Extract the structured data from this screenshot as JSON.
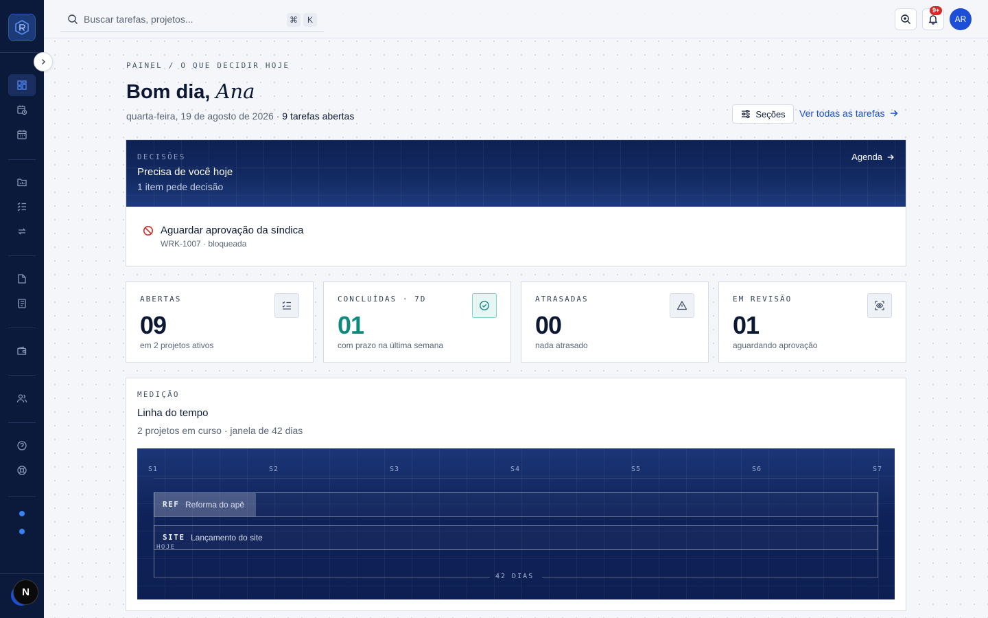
{
  "colors": {
    "sidebar_bg": "#0b1a3a",
    "accent": "#1d4ed8",
    "teal": "#0d8a7c",
    "danger": "#dc2626",
    "banner": "#132a62"
  },
  "sidebar": {
    "items": [
      {
        "icon": "dashboard-icon",
        "active": true
      },
      {
        "icon": "calendar-clock-icon"
      },
      {
        "icon": "calendar-icon"
      },
      {
        "icon": "folder-chart-icon"
      },
      {
        "icon": "checklist-icon"
      },
      {
        "icon": "repeat-icon"
      },
      {
        "icon": "file-icon"
      },
      {
        "icon": "notebook-icon"
      },
      {
        "icon": "wallet-icon"
      },
      {
        "icon": "users-icon"
      },
      {
        "icon": "help-icon"
      },
      {
        "icon": "lifebuoy-icon"
      }
    ],
    "badge_letter": "N"
  },
  "topbar": {
    "search_placeholder": "Buscar tarefas, projetos...",
    "shortcut_cmd": "⌘",
    "shortcut_key": "K",
    "notif_badge": "9+",
    "avatar_initials": "AR"
  },
  "header": {
    "breadcrumb": "PAINEL / O QUE DECIDIR HOJE",
    "greeting": "Bom dia,",
    "name": "Ana",
    "date": "quarta-feira, 19 de agosto de 2026 · ",
    "open_tasks": "9 tarefas abertas",
    "sections_button": "Seções",
    "all_tasks_link": "Ver todas as tarefas"
  },
  "decisions": {
    "label": "DECISÕES",
    "title": "Precisa de você hoje",
    "subtitle": "1 item pede decisão",
    "agenda_link": "Agenda",
    "items": [
      {
        "title": "Aguardar aprovação da síndica",
        "meta": "WRK-1007 · bloqueada"
      }
    ]
  },
  "stats": [
    {
      "label": "ABERTAS",
      "value": "09",
      "desc": "em 2 projetos ativos",
      "icon": "checklist-icon",
      "tone": "neutral"
    },
    {
      "label": "CONCLUÍDAS · 7D",
      "value": "01",
      "desc": "com prazo na última semana",
      "icon": "check-circle-icon",
      "tone": "teal"
    },
    {
      "label": "ATRASADAS",
      "value": "00",
      "desc": "nada atrasado",
      "icon": "warning-icon",
      "tone": "neutral"
    },
    {
      "label": "EM REVISÃO",
      "value": "01",
      "desc": "aguardando aprovação",
      "icon": "focus-eye-icon",
      "tone": "neutral"
    }
  ],
  "timeline": {
    "label": "MEDIÇÃO",
    "title": "Linha do tempo",
    "subtitle": "2 projetos em curso · janela de 42 dias",
    "weeks": [
      "S1",
      "S2",
      "S3",
      "S4",
      "S5",
      "S6",
      "S7"
    ],
    "window_days": 42,
    "projects": [
      {
        "code": "REF",
        "name": "Reforma do apê",
        "progress": 0.14
      },
      {
        "code": "SITE",
        "name": "Lançamento do site",
        "progress": 0
      }
    ],
    "today_label": "HOJE",
    "span_label": "42 DIAS"
  }
}
